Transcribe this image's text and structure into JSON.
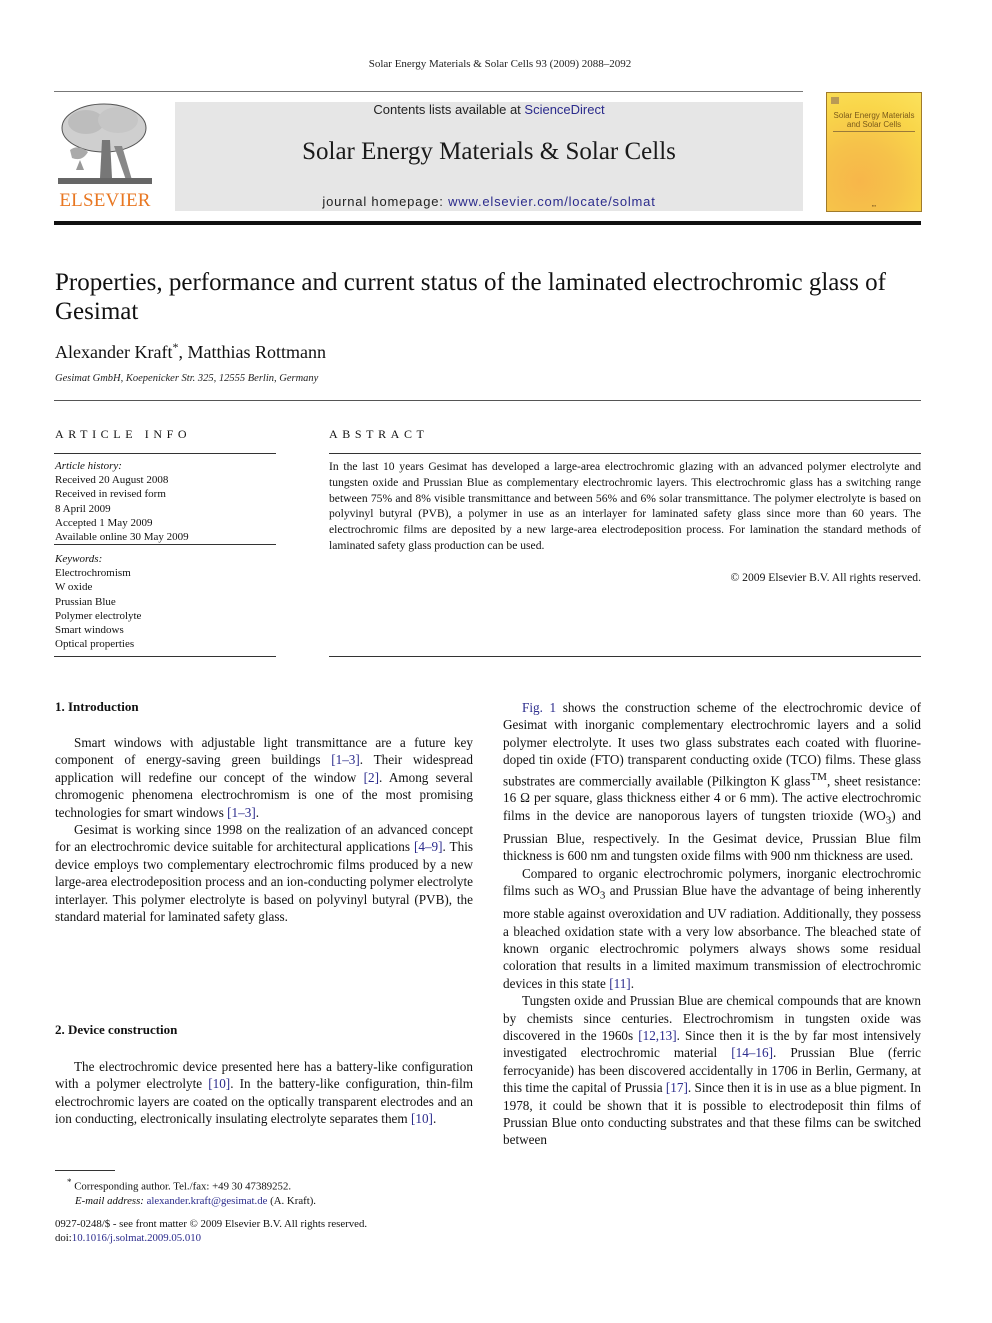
{
  "header": {
    "running_head": "Solar Energy Materials & Solar Cells 93 (2009) 2088–2092",
    "publisher_logo_text": "ELSEVIER",
    "contents_prefix": "Contents lists available at ",
    "contents_link": "ScienceDirect",
    "journal_title": "Solar Energy Materials & Solar Cells",
    "homepage_prefix": "journal homepage: ",
    "homepage_link": "www.elsevier.com/locate/solmat",
    "cover": {
      "title_line1": "Solar Energy Materials",
      "title_line2": "and Solar Cells"
    },
    "colors": {
      "elsevier_orange": "#e87722",
      "link_blue": "#2b2b8c",
      "banner_gray": "#e6e6e6"
    }
  },
  "article": {
    "title": "Properties, performance and current status of the laminated electrochromic glass of Gesimat",
    "authors": {
      "author1": "Alexander Kraft",
      "author1_mark": "*",
      "separator": ", ",
      "author2": "Matthias Rottmann"
    },
    "affiliation": "Gesimat GmbH, Koepenicker Str. 325, 12555 Berlin, Germany"
  },
  "article_info": {
    "heading": "ARTICLE INFO",
    "history_label": "Article history:",
    "history": [
      "Received 20 August 2008",
      "Received in revised form",
      "8 April 2009",
      "Accepted 1 May 2009",
      "Available online 30 May 2009"
    ],
    "keywords_label": "Keywords:",
    "keywords": [
      "Electrochromism",
      "W oxide",
      "Prussian Blue",
      "Polymer electrolyte",
      "Smart windows",
      "Optical properties"
    ]
  },
  "abstract": {
    "heading": "ABSTRACT",
    "text": "In the last 10 years Gesimat has developed a large-area electrochromic glazing with an advanced polymer electrolyte and tungsten oxide and Prussian Blue as complementary electrochromic layers. This electrochromic glass has a switching range between 75% and 8% visible transmittance and between 56% and 6% solar transmittance. The polymer electrolyte is based on polyvinyl butyral (PVB), a polymer in use as an interlayer for laminated safety glass since more than 60 years. The electrochromic films are deposited by a new large-area electrodeposition process. For lamination the standard methods of laminated safety glass production can be used.",
    "copyright": "© 2009 Elsevier B.V. All rights reserved."
  },
  "body": {
    "section1": {
      "heading": "1.  Introduction",
      "p1": [
        "Smart windows with adjustable light transmittance are a future key component of energy-saving green buildings ",
        "[1–3]",
        ". Their widespread application will redefine our concept of the window ",
        "[2]",
        ". Among several chromogenic phenomena electrochromism is one of the most promising technologies for smart windows ",
        "[1–3]",
        "."
      ],
      "p2": [
        "Gesimat is working since 1998 on the realization of an advanced concept for an electrochromic device suitable for architectural applications ",
        "[4–9]",
        ". This device employs two complementary electrochromic films produced by a new large-area electrodeposition process and an ion-conducting polymer electrolyte interlayer. This polymer electrolyte is based on polyvinyl butyral (PVB), the standard material for laminated safety glass."
      ]
    },
    "section2": {
      "heading": "2.  Device construction",
      "p1": [
        "The electrochromic device presented here has a battery-like configuration with a polymer electrolyte ",
        "[10]",
        ". In the battery-like configuration, thin-film electrochromic layers are coated on the optically transparent electrodes and an ion conducting, electronically insulating electrolyte separates them ",
        "[10]",
        "."
      ]
    },
    "right_column": {
      "p1": [
        "Fig. 1",
        " shows the construction scheme of the electrochromic device of Gesimat with inorganic complementary electrochromic layers and a solid polymer electrolyte. It uses two glass substrates each coated with fluorine-doped tin oxide (FTO) transparent conducting oxide (TCO) films. These glass substrates are commercially available (Pilkington K glass",
        "TM",
        ", sheet resistance: 16 Ω per square, glass thickness either 4 or 6 mm). The active electrochromic films in the device are nanoporous layers of tungsten trioxide (WO",
        "3",
        ") and Prussian Blue, respectively. In the Gesimat device, Prussian Blue film thickness is 600 nm and tungsten oxide films with 900 nm thickness are used."
      ],
      "p2": [
        "Compared to organic electrochromic polymers, inorganic electrochromic films such as WO",
        "3",
        " and Prussian Blue have the advantage of being inherently more stable against overoxidation and UV radiation. Additionally, they possess a bleached oxidation state with a very low absorbance. The bleached state of known organic electrochromic polymers always shows some residual coloration that results in a limited maximum transmission of electrochromic devices in this state ",
        "[11]",
        "."
      ],
      "p3": [
        "Tungsten oxide and Prussian Blue are chemical compounds that are known by chemists since centuries. Electrochromism in tungsten oxide was discovered in the 1960s ",
        "[12,13]",
        ". Since then it is the by far most intensively investigated electrochromic material ",
        "[14–16]",
        ". Prussian Blue (ferric ferrocyanide) has been discovered accidentally in 1706 in Berlin, Germany, at this time the capital of Prussia ",
        "[17]",
        ". Since then it is in use as a blue pigment. In 1978, it could be shown that it is possible to electrodeposit thin films of Prussian Blue onto conducting substrates and that these films can be switched between"
      ]
    }
  },
  "footnotes": {
    "corresponding_mark": "*",
    "corresponding": " Corresponding author. Tel./fax: +49 30 47389252.",
    "email_label": "E-mail address: ",
    "email": "alexander.kraft@gesimat.de",
    "email_suffix": " (A. Kraft).",
    "front_matter": "0927-0248/$ - see front matter © 2009 Elsevier B.V. All rights reserved.",
    "doi_prefix": "doi:",
    "doi": "10.1016/j.solmat.2009.05.010"
  }
}
